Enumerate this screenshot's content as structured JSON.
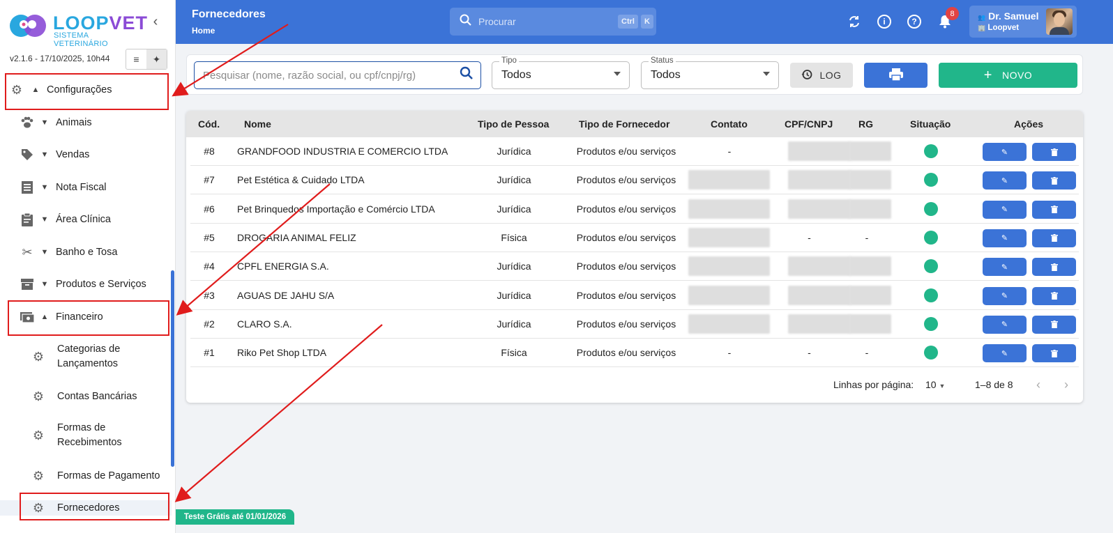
{
  "sidebar": {
    "logo_word_a": "LOOP",
    "logo_word_b": "VET",
    "logo_sub": "SISTEMA VETERINÁRIO",
    "version": "v2.1.6 - 17/10/2025, 10h44",
    "nav": [
      {
        "label": "Configurações",
        "icon": "gear-icon"
      },
      {
        "label": "Animais",
        "icon": "paw-icon"
      },
      {
        "label": "Vendas",
        "icon": "tag-icon"
      },
      {
        "label": "Nota Fiscal",
        "icon": "receipt-icon"
      },
      {
        "label": "Área Clínica",
        "icon": "clipboard-icon"
      },
      {
        "label": "Banho e Tosa",
        "icon": "scissors-icon"
      },
      {
        "label": "Produtos e Serviços",
        "icon": "archive-icon"
      },
      {
        "label": "Financeiro",
        "icon": "cash-icon"
      }
    ],
    "sub_items": [
      {
        "label": "Categorias de Lançamentos"
      },
      {
        "label": "Contas Bancárias"
      },
      {
        "label": "Formas de Recebimentos"
      },
      {
        "label": "Formas de Pagamento"
      },
      {
        "label": "Fornecedores"
      }
    ],
    "trial": "Teste Grátis até 01/01/2026"
  },
  "header": {
    "title": "Fornecedores",
    "breadcrumb": "Home",
    "search_placeholder": "Procurar",
    "kbd_ctrl": "Ctrl",
    "kbd_k": "K",
    "notifications": "8",
    "user_name": "Dr. Samuel",
    "user_clinic": "Loopvet"
  },
  "toolbar": {
    "search_placeholder": "Pesquisar (nome, razão social, ou cpf/cnpj/rg)",
    "tipo_label": "Tipo",
    "tipo_value": "Todos",
    "status_label": "Status",
    "status_value": "Todos",
    "log_label": "LOG",
    "new_label": "NOVO"
  },
  "table": {
    "columns": [
      "Cód.",
      "Nome",
      "Tipo de Pessoa",
      "Tipo de Fornecedor",
      "Contato",
      "CPF/CNPJ",
      "RG",
      "Situação",
      "Ações"
    ],
    "rows": [
      {
        "cod": "#8",
        "nome": "GRANDFOOD INDUSTRIA E COMERCIO LTDA",
        "pessoa": "Jurídica",
        "fornecedor": "Produtos e/ou serviços",
        "contato": "-",
        "cpf": "",
        "rg": ""
      },
      {
        "cod": "#7",
        "nome": "Pet Estética & Cuidado LTDA",
        "pessoa": "Jurídica",
        "fornecedor": "Produtos e/ou serviços",
        "contato": "",
        "cpf": "",
        "rg": ""
      },
      {
        "cod": "#6",
        "nome": "Pet Brinquedos Importação e Comércio LTDA",
        "pessoa": "Jurídica",
        "fornecedor": "Produtos e/ou serviços",
        "contato": "",
        "cpf": "",
        "rg": ""
      },
      {
        "cod": "#5",
        "nome": "DROGARIA ANIMAL FELIZ",
        "pessoa": "Física",
        "fornecedor": "Produtos e/ou serviços",
        "contato": "",
        "cpf": "-",
        "rg": "-"
      },
      {
        "cod": "#4",
        "nome": "CPFL ENERGIA S.A.",
        "pessoa": "Jurídica",
        "fornecedor": "Produtos e/ou serviços",
        "contato": "",
        "cpf": "",
        "rg": ""
      },
      {
        "cod": "#3",
        "nome": "AGUAS DE JAHU S/A",
        "pessoa": "Jurídica",
        "fornecedor": "Produtos e/ou serviços",
        "contato": "",
        "cpf": "",
        "rg": ""
      },
      {
        "cod": "#2",
        "nome": "CLARO S.A.",
        "pessoa": "Jurídica",
        "fornecedor": "Produtos e/ou serviços",
        "contato": "",
        "cpf": "",
        "rg": ""
      },
      {
        "cod": "#1",
        "nome": "Riko Pet Shop LTDA",
        "pessoa": "Física",
        "fornecedor": "Produtos e/ou serviços",
        "contato": "-",
        "cpf": "-",
        "rg": "-"
      }
    ],
    "rows_per_page_label": "Linhas por página:",
    "rows_per_page": "10",
    "range": "1–8 de 8"
  },
  "colors": {
    "header_blue": "#3b73d7",
    "accent_green": "#21b68a",
    "annotation_red": "#e01c1c"
  }
}
